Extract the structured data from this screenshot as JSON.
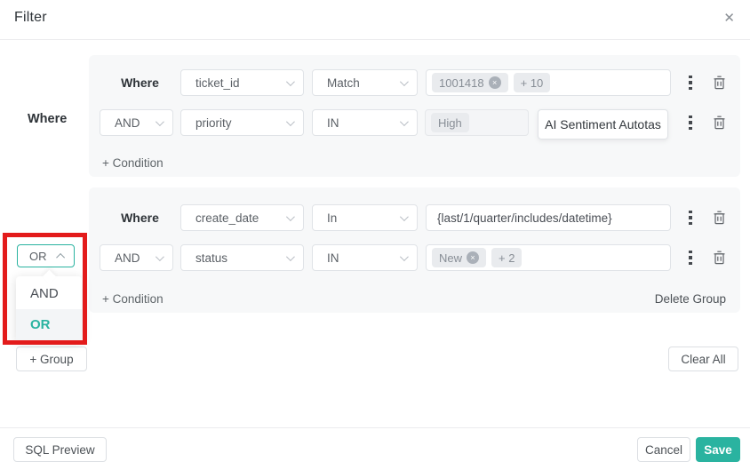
{
  "header": {
    "title": "Filter"
  },
  "icons": {
    "close": "✕",
    "tag_remove": "×"
  },
  "sidebar": {
    "where_label": "Where"
  },
  "logic_dropdown": {
    "value": "OR",
    "options": {
      "and": "AND",
      "or": "OR"
    }
  },
  "groups": [
    {
      "rows": [
        {
          "join": "Where",
          "field": "ticket_id",
          "op": "Match",
          "tags": [
            "1001418",
            "+ 10"
          ]
        },
        {
          "join": "AND",
          "field": "priority",
          "op": "IN",
          "tags": [
            "High"
          ],
          "suggestion": "AI Sentiment Autotas"
        }
      ],
      "add_condition": "+ Condition"
    },
    {
      "rows": [
        {
          "join": "Where",
          "field": "create_date",
          "op": "In",
          "value": "{last/1/quarter/includes/datetime}"
        },
        {
          "join": "AND",
          "field": "status",
          "op": "IN",
          "tags": [
            "New",
            "+ 2"
          ]
        }
      ],
      "add_condition": "+ Condition",
      "delete_group": "Delete Group"
    }
  ],
  "actions": {
    "add_group": "+ Group",
    "clear_all": "Clear All"
  },
  "footer": {
    "sql_preview": "SQL Preview",
    "cancel": "Cancel",
    "save": "Save"
  },
  "colors": {
    "accent": "#2ab3a0",
    "annotation_red": "#e31b1b"
  }
}
